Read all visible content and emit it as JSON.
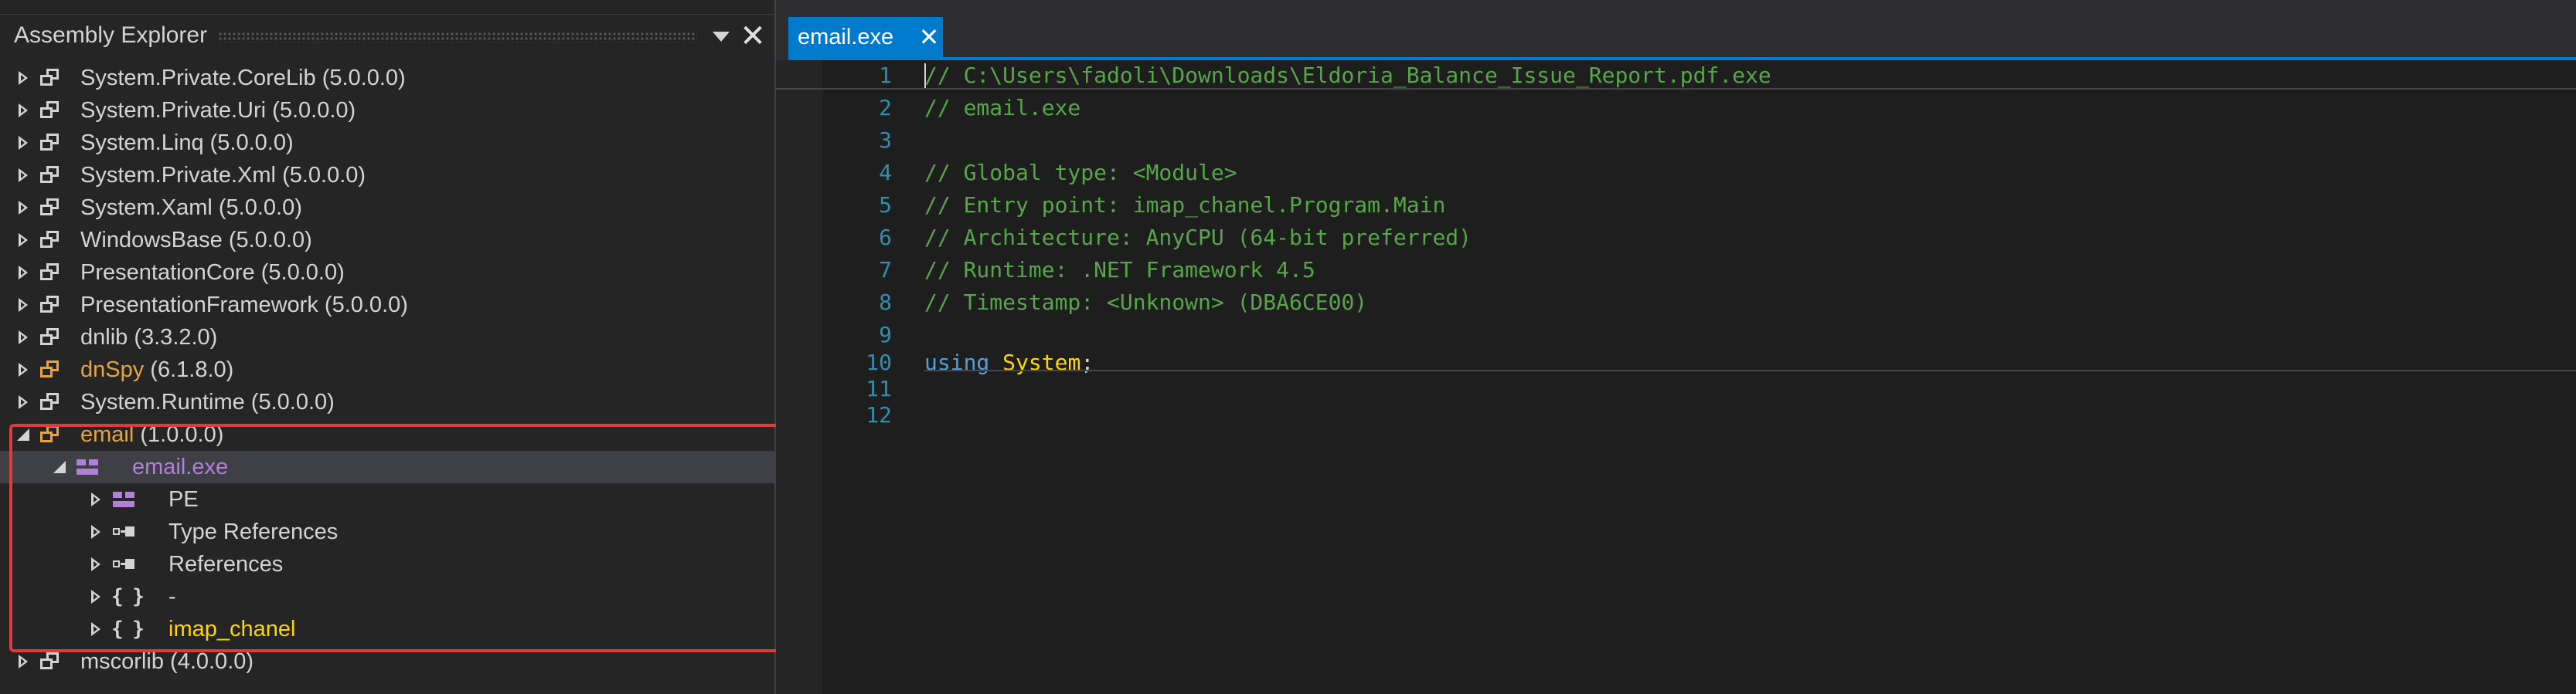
{
  "explorer": {
    "title": "Assembly Explorer",
    "tree": [
      {
        "name": "System.Private.CoreLib",
        "version": "(5.0.0.0)",
        "icon": "assembly-icon",
        "level": 0,
        "state": "collapsed"
      },
      {
        "name": "System.Private.Uri",
        "version": "(5.0.0.0)",
        "icon": "assembly-icon",
        "level": 0,
        "state": "collapsed"
      },
      {
        "name": "System.Linq",
        "version": "(5.0.0.0)",
        "icon": "assembly-icon",
        "level": 0,
        "state": "collapsed"
      },
      {
        "name": "System.Private.Xml",
        "version": "(5.0.0.0)",
        "icon": "assembly-icon",
        "level": 0,
        "state": "collapsed"
      },
      {
        "name": "System.Xaml",
        "version": "(5.0.0.0)",
        "icon": "assembly-icon",
        "level": 0,
        "state": "collapsed"
      },
      {
        "name": "WindowsBase",
        "version": "(5.0.0.0)",
        "icon": "assembly-icon",
        "level": 0,
        "state": "collapsed"
      },
      {
        "name": "PresentationCore",
        "version": "(5.0.0.0)",
        "icon": "assembly-icon",
        "level": 0,
        "state": "collapsed"
      },
      {
        "name": "PresentationFramework",
        "version": "(5.0.0.0)",
        "icon": "assembly-icon",
        "level": 0,
        "state": "collapsed"
      },
      {
        "name": "dnlib",
        "version": "(3.3.2.0)",
        "icon": "assembly-icon",
        "level": 0,
        "state": "collapsed"
      },
      {
        "name": "dnSpy",
        "version": "(6.1.8.0)",
        "icon": "assembly-icon-orange",
        "level": 0,
        "state": "collapsed",
        "color": "orange"
      },
      {
        "name": "System.Runtime",
        "version": "(5.0.0.0)",
        "icon": "assembly-icon",
        "level": 0,
        "state": "collapsed"
      },
      {
        "name": "email",
        "version": "(1.0.0.0)",
        "icon": "assembly-icon-orange",
        "level": 0,
        "state": "expanded",
        "color": "orange"
      },
      {
        "name": "email.exe",
        "version": "",
        "icon": "module-icon",
        "level": 1,
        "state": "expanded",
        "color": "purple",
        "selected": true
      },
      {
        "name": "PE",
        "version": "",
        "icon": "module-icon",
        "level": 2,
        "state": "collapsed"
      },
      {
        "name": "Type References",
        "version": "",
        "icon": "reference-icon",
        "level": 2,
        "state": "collapsed"
      },
      {
        "name": "References",
        "version": "",
        "icon": "reference-icon",
        "level": 2,
        "state": "collapsed"
      },
      {
        "name": "-",
        "version": "",
        "icon": "namespace-icon",
        "level": 2,
        "state": "collapsed"
      },
      {
        "name": "imap_chanel",
        "version": "",
        "icon": "namespace-icon",
        "level": 2,
        "state": "collapsed",
        "color": "yellow"
      },
      {
        "name": "mscorlib",
        "version": "(4.0.0.0)",
        "icon": "assembly-icon",
        "level": 0,
        "state": "collapsed"
      }
    ]
  },
  "tab": {
    "label": "email.exe",
    "close_glyph": "✕"
  },
  "panel": {
    "close_glyph": "✕"
  },
  "code": [
    {
      "n": "1",
      "tokens": [
        {
          "t": "// C:\\Users\\fadoli\\Downloads\\Eldoria_Balance_Issue_Report.pdf.exe",
          "c": "cmt"
        }
      ]
    },
    {
      "n": "2",
      "tokens": [
        {
          "t": "// email.exe",
          "c": "cmt"
        }
      ]
    },
    {
      "n": "3",
      "tokens": []
    },
    {
      "n": "4",
      "tokens": [
        {
          "t": "// Global type: <Module>",
          "c": "cmt"
        }
      ]
    },
    {
      "n": "5",
      "tokens": [
        {
          "t": "// Entry point: imap_chanel.Program.Main",
          "c": "cmt"
        }
      ]
    },
    {
      "n": "6",
      "tokens": [
        {
          "t": "// Architecture: AnyCPU (64-bit preferred)",
          "c": "cmt"
        }
      ]
    },
    {
      "n": "7",
      "tokens": [
        {
          "t": "// Runtime: .NET Framework 4.5",
          "c": "cmt"
        }
      ]
    },
    {
      "n": "8",
      "tokens": [
        {
          "t": "// Timestamp: <Unknown> (DBA6CE00)",
          "c": "cmt"
        }
      ]
    },
    {
      "n": "9",
      "tokens": []
    },
    {
      "n": "10",
      "tokens": [
        {
          "t": "using",
          "c": "kw"
        },
        {
          "t": " ",
          "c": "plain"
        },
        {
          "t": "System",
          "c": "typ"
        },
        {
          "t": ";",
          "c": "plain"
        }
      ]
    },
    {
      "n": "11",
      "tokens": []
    },
    {
      "n": "12",
      "tokens": []
    }
  ],
  "colors": {
    "accent": "#007acc",
    "highlight_box": "#e03a3a",
    "comment": "#57a64a",
    "keyword": "#569cd6",
    "type": "#ffd700",
    "assembly_orange": "#e8a33e",
    "module_purple": "#b180d7"
  }
}
